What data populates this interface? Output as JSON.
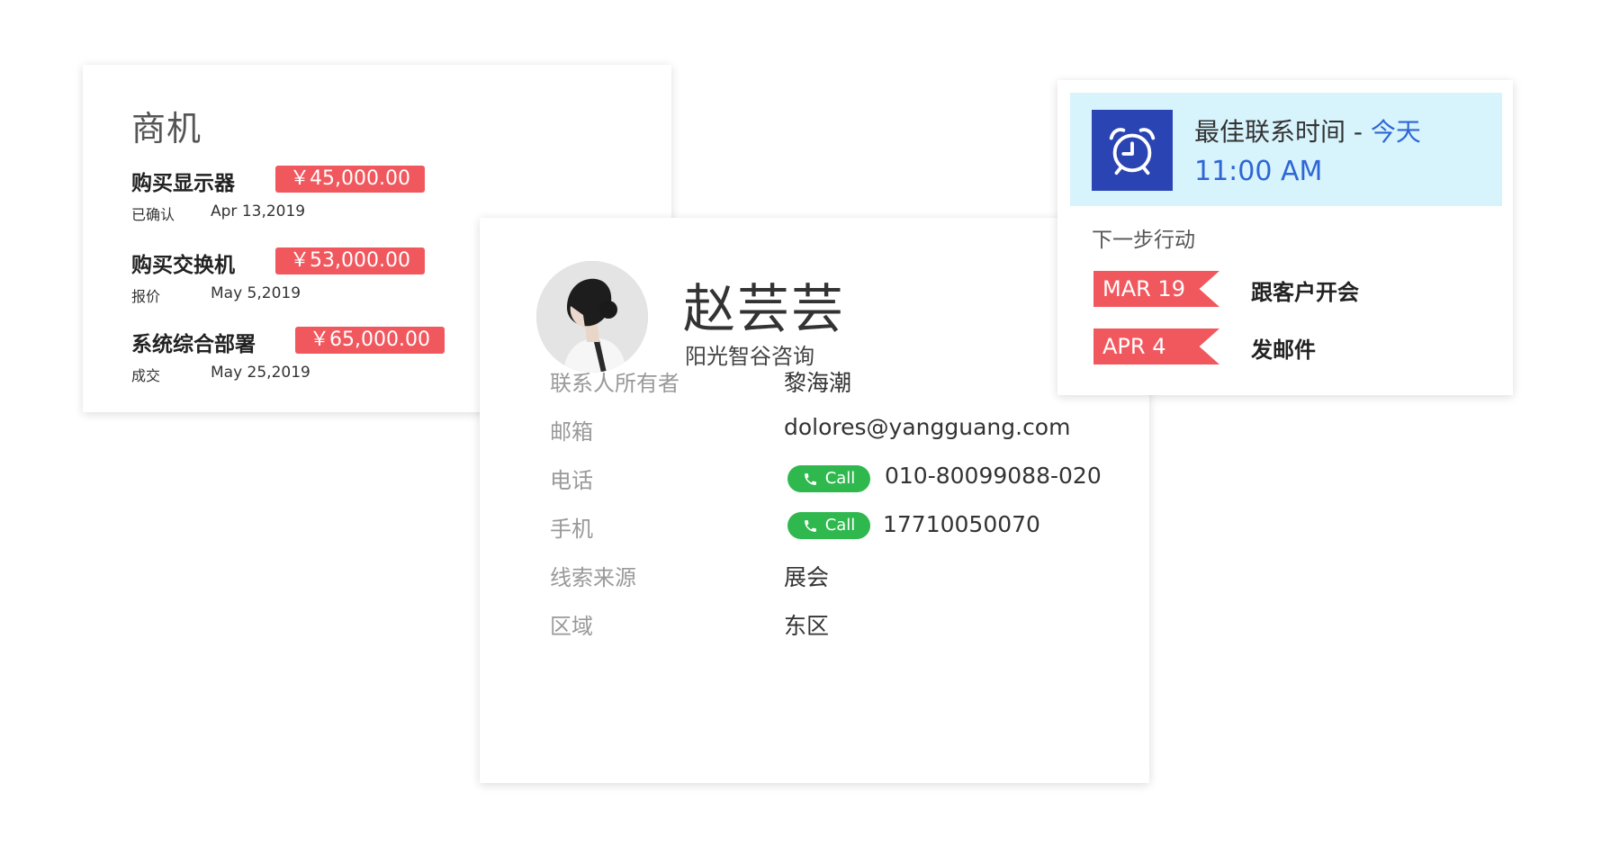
{
  "deals": {
    "title": "商机",
    "items": [
      {
        "name": "购买显示器",
        "amount": "￥45,000.00",
        "status": "已确认",
        "date": "Apr 13,2019"
      },
      {
        "name": "购买交换机",
        "amount": "￥53,000.00",
        "status": "报价",
        "date": "May 5,2019"
      },
      {
        "name": "系统综合部署",
        "amount": "￥65,000.00",
        "status": "成交",
        "date": "May 25,2019"
      }
    ]
  },
  "contact": {
    "name": "赵芸芸",
    "company": "阳光智谷咨询",
    "fields": {
      "owner": {
        "label": "联系人所有者",
        "value": "黎海潮"
      },
      "email": {
        "label": "邮箱",
        "value": "dolores@yangguang.com"
      },
      "phone": {
        "label": "电话",
        "value": "010-80099088-020",
        "call_label": "Call"
      },
      "mobile": {
        "label": "手机",
        "value": "17710050070",
        "call_label": "Call"
      },
      "source": {
        "label": "线索来源",
        "value": "展会"
      },
      "region": {
        "label": "区域",
        "value": "东区"
      }
    }
  },
  "action": {
    "best_time_label": "最佳联系时间",
    "best_time_sep": " - ",
    "best_time_day": "今天",
    "best_time": "11:00 AM",
    "next_heading": "下一步行动",
    "items": [
      {
        "date": "MAR 19",
        "text": "跟客户开会"
      },
      {
        "date": "APR 4",
        "text": "发邮件"
      }
    ]
  },
  "colors": {
    "accent_red": "#f0585e",
    "call_green": "#2fb84d",
    "clock_blue": "#2b44b4",
    "highlight_blue": "#2f66d6",
    "banner_bg": "#d7f4fd"
  },
  "icons": {
    "clock": "alarm-clock-icon",
    "phone": "phone-icon",
    "avatar": "avatar-photo"
  }
}
